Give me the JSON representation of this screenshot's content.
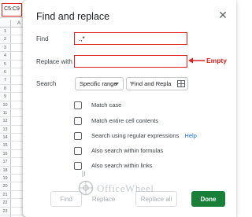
{
  "spreadsheet": {
    "name_box": "C5:C9",
    "column_header": "A",
    "row_numbers": [
      "1",
      "2",
      "3",
      "4",
      "5",
      "6",
      "7",
      "8",
      "9",
      "10",
      "11",
      "12",
      "13",
      "14",
      "15",
      "16",
      "17",
      "18",
      "19",
      "20",
      "21",
      "22",
      "23",
      "24"
    ]
  },
  "dialog": {
    "title": "Find and replace",
    "close_icon": "close-icon",
    "find": {
      "label": "Find",
      "value": ".,*"
    },
    "replace_with": {
      "label": "Replace with",
      "value": ""
    },
    "annotation": "Empty",
    "search": {
      "label": "Search",
      "mode": "Specific range",
      "range": "'Find and Repla",
      "range_icon": "grid-icon"
    },
    "options": [
      {
        "label": "Match case",
        "checked": false
      },
      {
        "label": "Match entire cell contents",
        "checked": false
      },
      {
        "label": "Search using regular expressions",
        "checked": false,
        "help": "Help"
      },
      {
        "label": "Also search within formulas",
        "checked": false
      },
      {
        "label": "Also search within links",
        "checked": false
      }
    ],
    "buttons": {
      "find": "Find",
      "replace": "Replace",
      "replace_all": "Replace all",
      "done": "Done"
    }
  },
  "watermark": {
    "text": "OfficeWheel"
  },
  "colors": {
    "highlight": "#e0201c",
    "done_button": "#188038",
    "link": "#1a73e8"
  }
}
